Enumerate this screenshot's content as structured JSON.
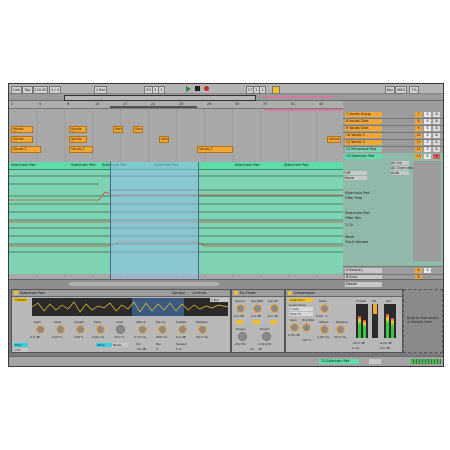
{
  "control_bar": {
    "link": "Link",
    "tap": "Tap",
    "tempo": "120.00",
    "sig": "4 / 4",
    "loop_len": "1 Bar",
    "pos1": "53",
    "pos2": "1",
    "pos3": "1",
    "len1": "17",
    "len2": "1",
    "len3": "1",
    "key": "Key",
    "midi": "MIDI",
    "cpu": "7%"
  },
  "ruler_marks": [
    "1",
    "5",
    "9",
    "13",
    "17",
    "21",
    "25",
    "29",
    "33",
    "37",
    "41",
    "45"
  ],
  "clips": [
    {
      "label": "Vocals Slice"
    },
    {
      "label": "Vocals Slice"
    },
    {
      "label": "Vocals 2"
    },
    {
      "label": "Vocals Slice"
    },
    {
      "label": "Vocals Slice"
    },
    {
      "label": "Vocals 2"
    },
    {
      "label": "Vocals"
    },
    {
      "label": "Vocals"
    },
    {
      "label": "Vocals"
    },
    {
      "label": "Vocals 2"
    },
    {
      "label": "Vocals"
    }
  ],
  "sidechain_clips": [
    "Sidechain Pad",
    "Sidechain Pad",
    "Sidechain Pad",
    "Sidechain Pad",
    "Sidechain Pad",
    "Sidechain Pad"
  ],
  "automation_lanes": [
    {
      "title": "Sidechain Pad",
      "param": "Filter Freq"
    },
    {
      "title": "Sidechain Pad",
      "param": "Filter Res"
    },
    {
      "title": "",
      "param": "Mixer"
    },
    {
      "title": "",
      "param": "Track Volume"
    }
  ],
  "automation_extra": "1 Ch",
  "tracks": [
    {
      "name": "7 Vocals Group",
      "num": "7"
    },
    {
      "name": "8 Vocals Slice",
      "num": "8"
    },
    {
      "name": "9 Vocals Slice",
      "num": "9"
    },
    {
      "name": "10 Vocals 2",
      "num": "10"
    },
    {
      "name": "11 Vocals 3",
      "num": "11"
    },
    {
      "name": "12 Microwave Pad",
      "num": "12"
    },
    {
      "name": "13 Sidechain Pad",
      "num": "13"
    },
    {
      "name": "A Reverb | Compressor",
      "num": "A"
    },
    {
      "name": "B Echo",
      "num": "B"
    },
    {
      "name": "Master",
      "num": ""
    }
  ],
  "track_io": [
    "All Ins",
    "All Channels",
    "Auto",
    "Off",
    "None"
  ],
  "solo_label": "S",
  "arm_label": "A",
  "devices": {
    "simpler": {
      "title": "Sidechain Pad",
      "tabs": [
        "Sample",
        "Controls"
      ],
      "mode": "Classic",
      "gain": "Gain",
      "start": "Start",
      "length": "Length",
      "fade": "Fade",
      "loop": "Loop",
      "filter": "Filter",
      "lfo": "LFO",
      "values": [
        "0.0 dB",
        "0.00 %",
        "100 %",
        "0.00 ms",
        "79.4 %"
      ],
      "env_labels": [
        "Attack",
        "Decay",
        "Sustain",
        "Release",
        "Vol",
        "Pan",
        "Spread"
      ],
      "env_values": [
        "0.10 ms",
        "600 ms",
        "0.0 dB",
        "50.0 ms",
        "-12 dB",
        "C",
        "0 %"
      ],
      "warp": "Warp",
      "beats": "Beats",
      "bar": "1 Bar"
    },
    "eq": {
      "title": "Eq Three",
      "knobs": [
        "GainLo",
        "GainMid",
        "GainHi"
      ],
      "values": [
        "0.0 dB",
        "0.0 dB",
        "0.0 dB"
      ],
      "freqs": [
        "FreqLo",
        "FreqHi"
      ],
      "freq_values": [
        "250 Hz",
        "2.50 kHz"
      ],
      "slope": [
        "24",
        "48"
      ]
    },
    "compressor": {
      "title": "Compressor",
      "sidechain": "Sidechain",
      "audio_from": "Audio From",
      "source": "1 Kick",
      "post": "Post FX",
      "gain": "Gain",
      "mix": "Dry/Wet",
      "values": [
        "0.00 dB",
        "100 %"
      ],
      "thresh": "Thresh",
      "gr": "GR",
      "out": "Out",
      "ratio": "Ratio",
      "attack": "Attack",
      "release": "Release",
      "ratio_val": "4.00 : 1",
      "attack_val": "2.00 ms",
      "release_val": "50.0 ms",
      "thresh_val": "-22.2 dB",
      "out_val": "0.00 dB",
      "lookahead": "0 ms",
      "knee": "6.0 dB"
    },
    "drop_hint": "Drop an Instrument or Sample Here"
  },
  "status": {
    "track": "13-Sidechain Pad"
  }
}
